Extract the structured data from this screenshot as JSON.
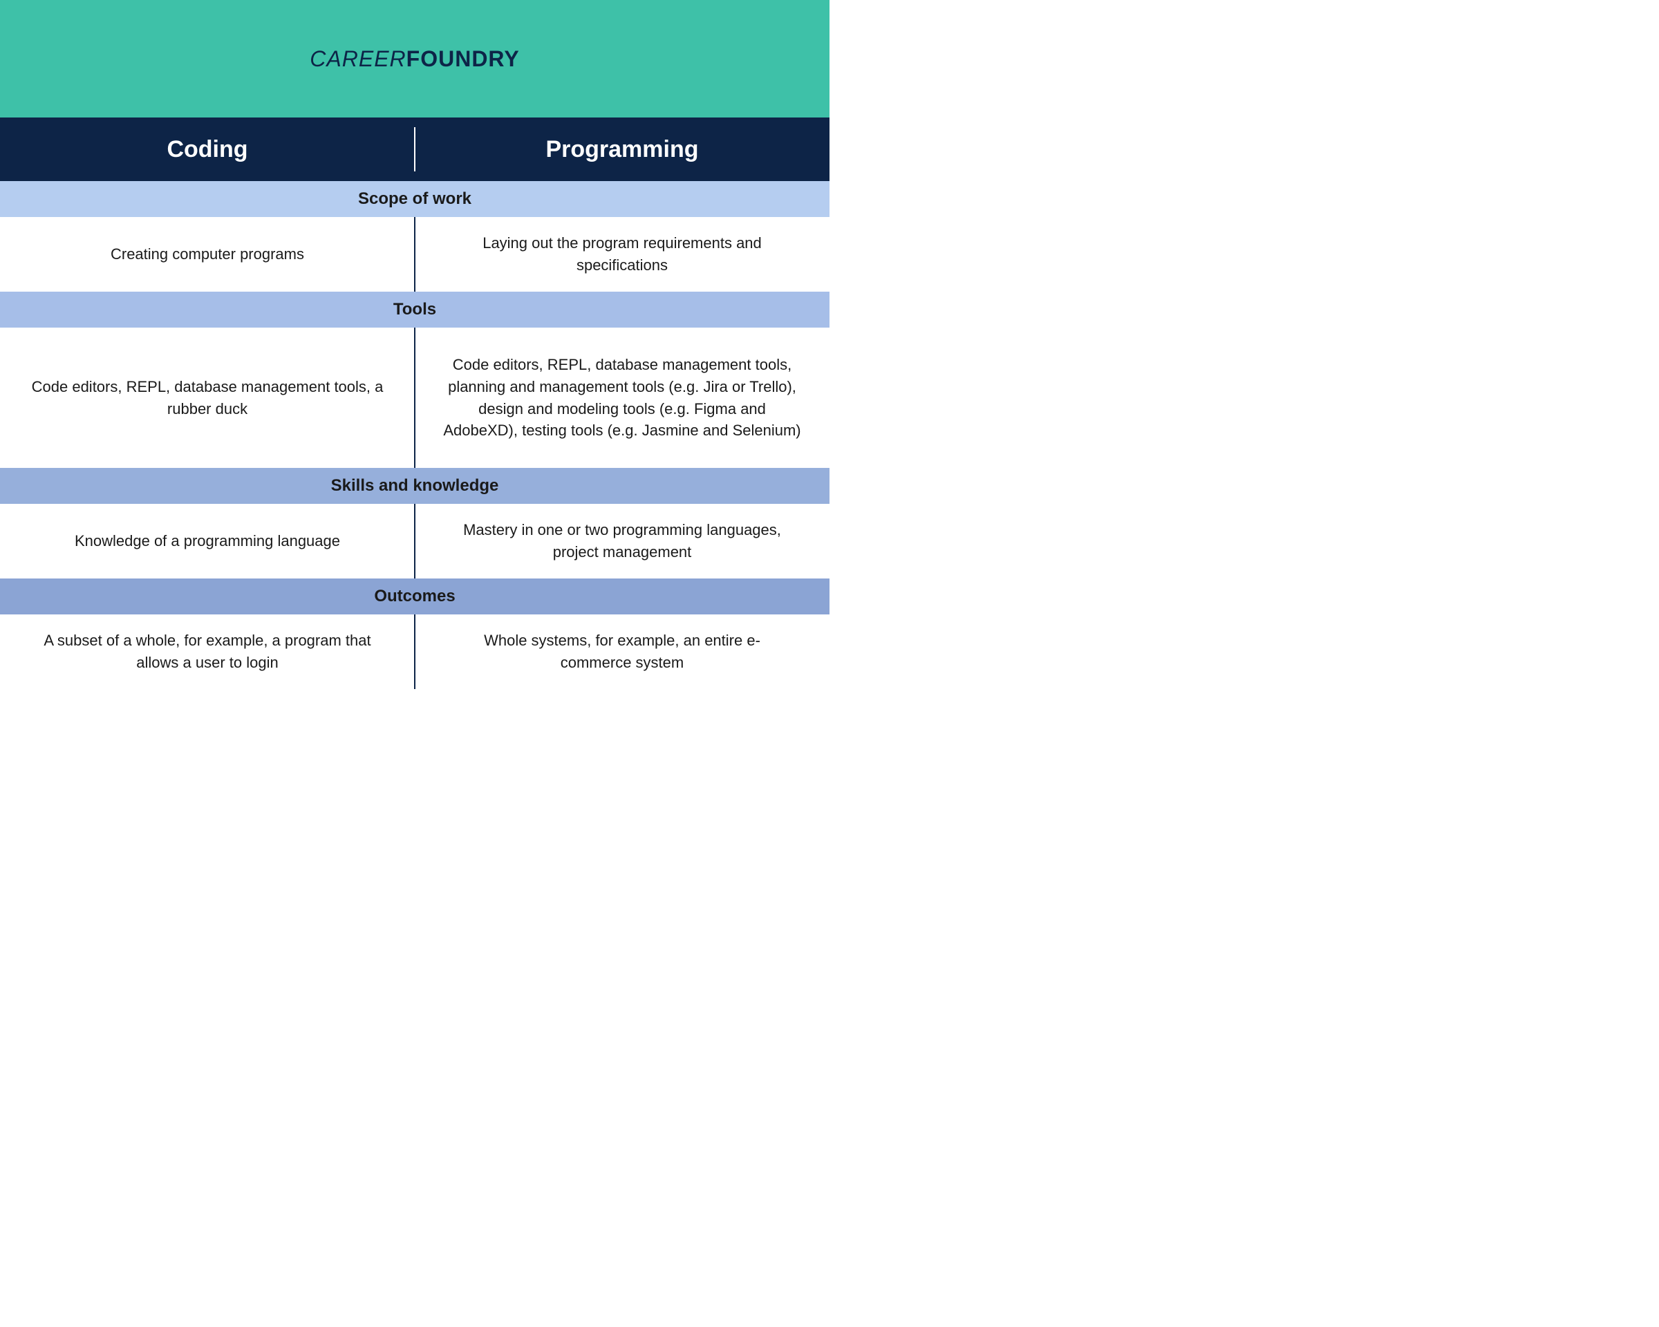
{
  "brand": {
    "part1": "CAREER",
    "part2": "FOUNDRY"
  },
  "columns": {
    "left": "Coding",
    "right": "Programming"
  },
  "sections": [
    {
      "title": "Scope of work",
      "shade": "light",
      "rowSize": "row-sm",
      "left": "Creating computer programs",
      "right": "Laying out the program requirements and specifications"
    },
    {
      "title": "Tools",
      "shade": "medium",
      "rowSize": "row-lg",
      "left": "Code editors, REPL, database management tools, a rubber duck",
      "right": "Code editors, REPL, database management tools, planning and management tools (e.g. Jira or Trello), design and modeling tools (e.g. Figma and AdobeXD), testing tools (e.g. Jasmine and Selenium)"
    },
    {
      "title": "Skills and knowledge",
      "shade": "dark",
      "rowSize": "row-sm",
      "left": "Knowledge of a programming language",
      "right": "Mastery in one or two programming languages, project management"
    },
    {
      "title": "Outcomes",
      "shade": "darker",
      "rowSize": "row-sm",
      "left": "A subset of a whole, for example, a program that allows a user to login",
      "right": "Whole systems, for example, an entire e-commerce system"
    }
  ]
}
